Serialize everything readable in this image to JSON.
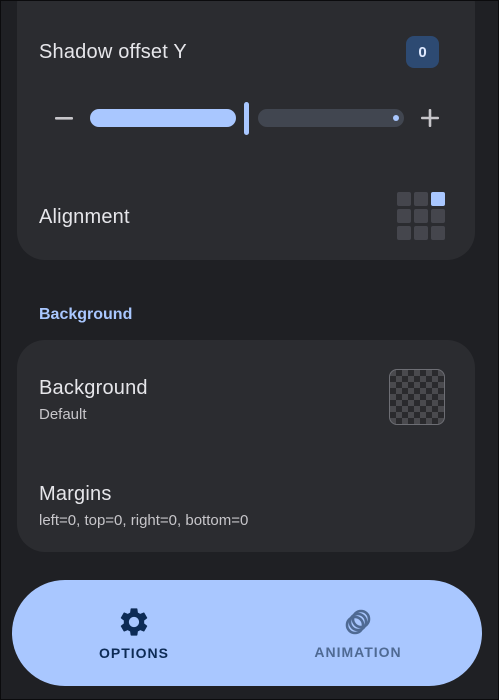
{
  "shadow_offset_y": {
    "label": "Shadow offset Y",
    "value": "0",
    "slider_fraction": 0.5,
    "decrease_icon": "minus-icon",
    "increase_icon": "plus-icon"
  },
  "alignment": {
    "label": "Alignment",
    "selected": "top-right"
  },
  "background_section": {
    "header": "Background",
    "background": {
      "label": "Background",
      "value": "Default"
    },
    "margins": {
      "label": "Margins",
      "value": "left=0, top=0, right=0, bottom=0"
    }
  },
  "bottom_nav": {
    "options": {
      "label": "OPTIONS",
      "icon": "gear-icon",
      "active": true
    },
    "animation": {
      "label": "ANIMATION",
      "icon": "circles-icon",
      "active": false
    }
  },
  "colors": {
    "background": "#1f2024",
    "card": "#2b2c30",
    "accent": "#a9c7ff",
    "badge": "#2d4a72"
  }
}
